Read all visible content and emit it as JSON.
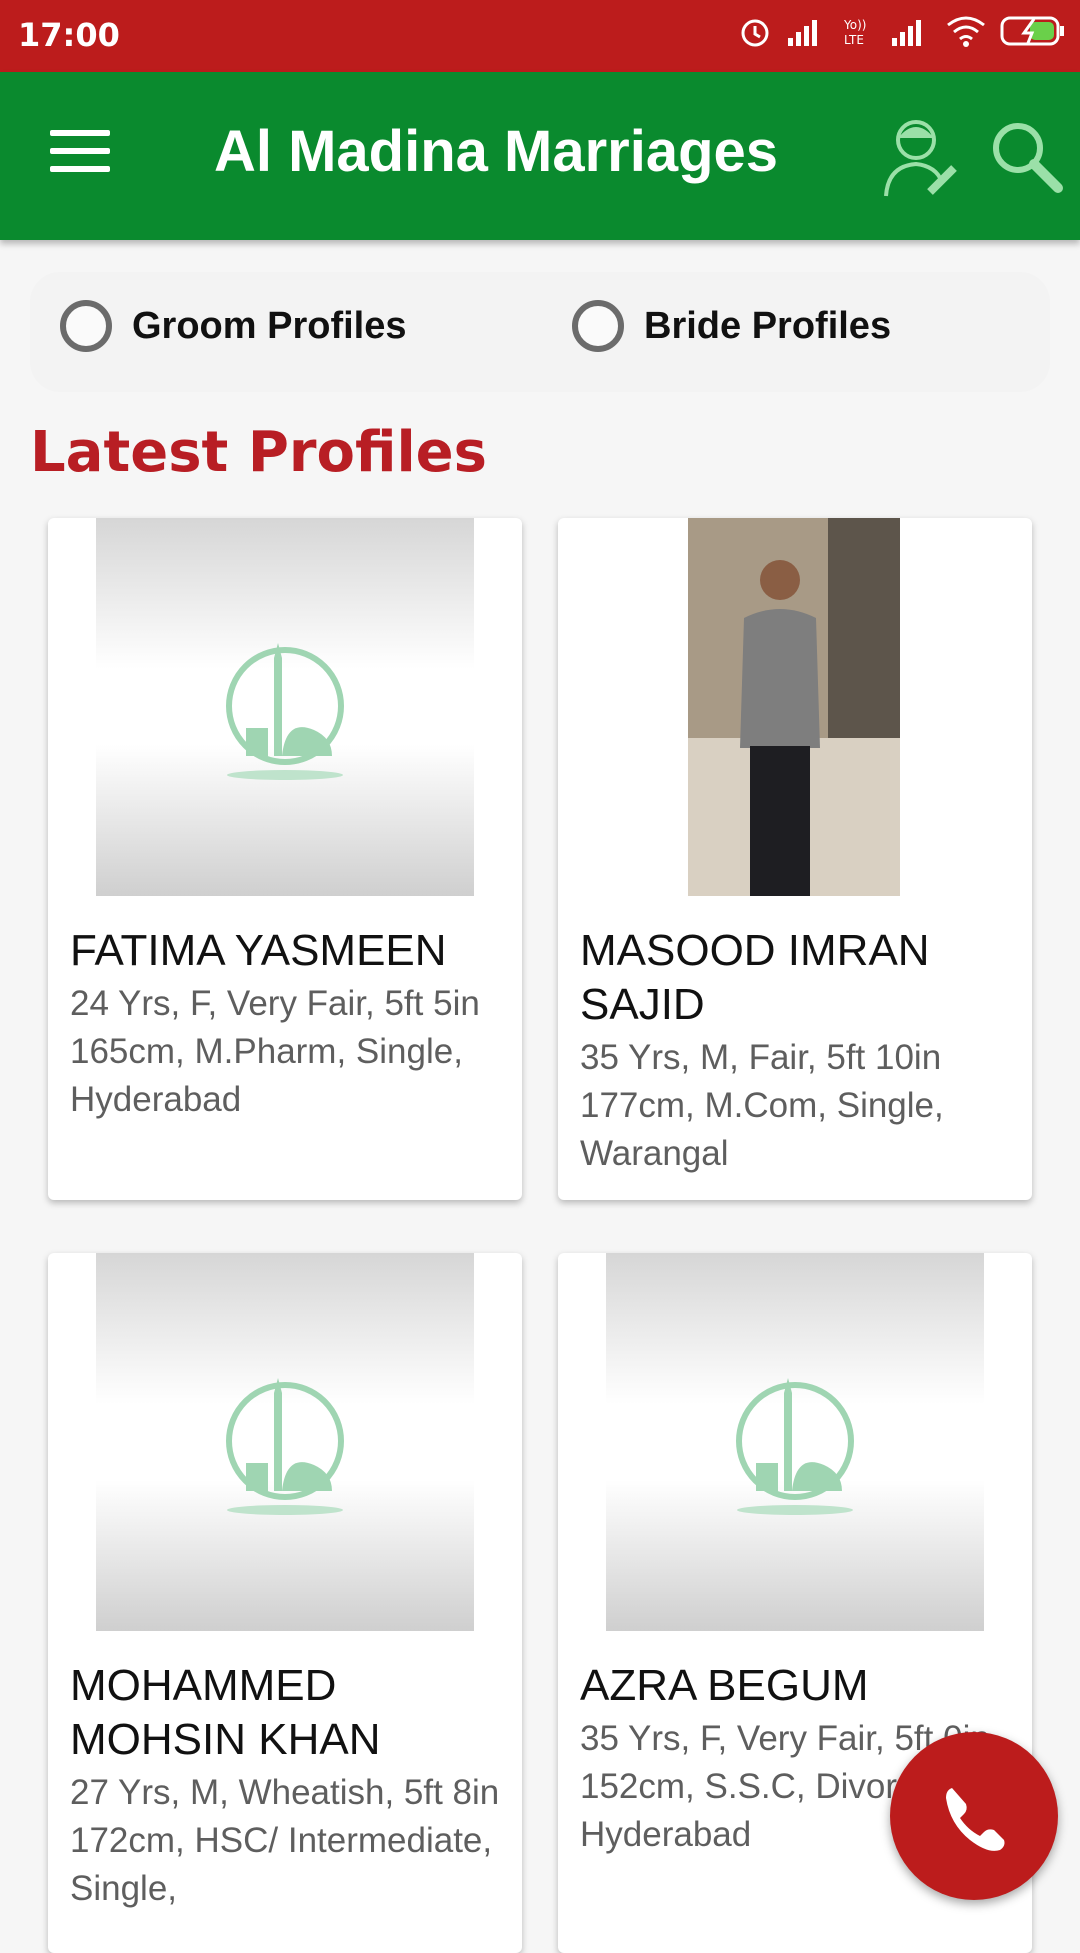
{
  "status": {
    "time": "17:00"
  },
  "appbar": {
    "title": "Al Madina Marriages"
  },
  "filters": {
    "groom": "Groom Profiles",
    "bride": "Bride Profiles"
  },
  "section": {
    "title": "Latest Profiles"
  },
  "profiles": [
    {
      "name": "FATIMA YASMEEN",
      "details": "24 Yrs, F, Very Fair, 5ft 5in 165cm, M.Pharm, Single, Hyderabad"
    },
    {
      "name": "MASOOD IMRAN SAJID",
      "details": "35 Yrs, M, Fair, 5ft 10in 177cm, M.Com, Single, Warangal"
    },
    {
      "name": "MOHAMMED MOHSIN KHAN",
      "details": "27 Yrs, M, Wheatish, 5ft 8in 172cm, HSC/ Intermediate, Single,"
    },
    {
      "name": "AZRA BEGUM",
      "details": "35 Yrs, F, Very Fair, 5ft 0in 152cm, S.S.C, Divorced, Hyderabad"
    }
  ]
}
